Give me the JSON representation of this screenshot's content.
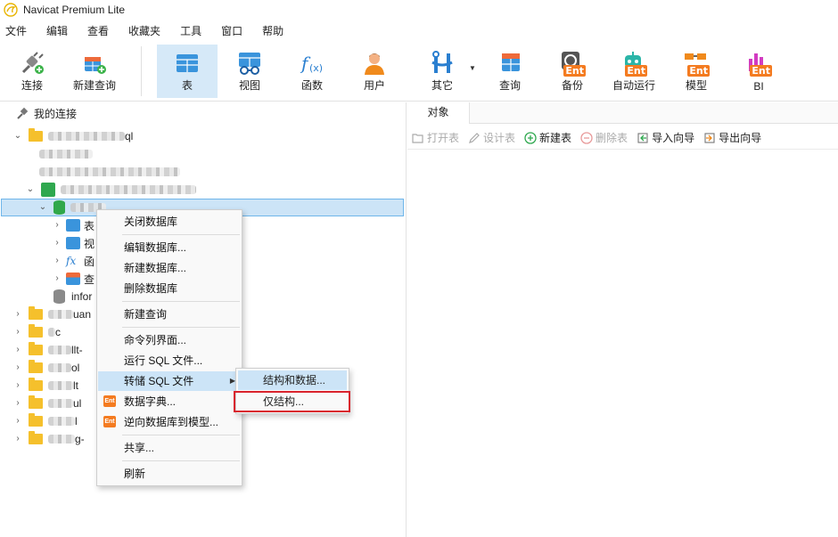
{
  "window": {
    "title": "Navicat Premium Lite"
  },
  "menubar": [
    "文件",
    "编辑",
    "查看",
    "收藏夹",
    "工具",
    "窗口",
    "帮助"
  ],
  "toolbar": {
    "connect": "连接",
    "new_query": "新建查询",
    "table": "表",
    "view": "视图",
    "function": "函数",
    "user": "用户",
    "other": "其它",
    "query": "查询",
    "backup": "备份",
    "auto_run": "自动运行",
    "model": "模型",
    "bi": "BI",
    "ent_badge": "Ent",
    "accent": "#2a8bd8",
    "active_bg": "#d6e9f8"
  },
  "tree": {
    "root": "我的连接",
    "conn1_suffix": "ql",
    "db_items": [
      "表",
      "视",
      "函",
      "查"
    ],
    "info_schema": "infor",
    "rows": [
      "uan",
      "c",
      "llt-",
      "ol",
      "lt",
      "ul",
      "l",
      "g-"
    ]
  },
  "right": {
    "tab": "对象",
    "actions": {
      "open_table": "打开表",
      "design_table": "设计表",
      "new_table": "新建表",
      "delete_table": "删除表",
      "import_wizard": "导入向导",
      "export_wizard": "导出向导"
    }
  },
  "context_menu": {
    "close_db": "关闭数据库",
    "edit_db": "编辑数据库...",
    "new_db": "新建数据库...",
    "delete_db": "删除数据库",
    "new_query": "新建查询",
    "cmd_line": "命令列界面...",
    "run_sql": "运行 SQL 文件...",
    "dump_sql": "转储 SQL 文件",
    "data_dict": "数据字典...",
    "reverse_model": "逆向数据库到模型...",
    "share": "共享...",
    "refresh": "刷新",
    "ent_badge": "Ent"
  },
  "submenu": {
    "structure_data": "结构和数据...",
    "structure_only": "仅结构...",
    "highlight_color": "#d9232d"
  }
}
